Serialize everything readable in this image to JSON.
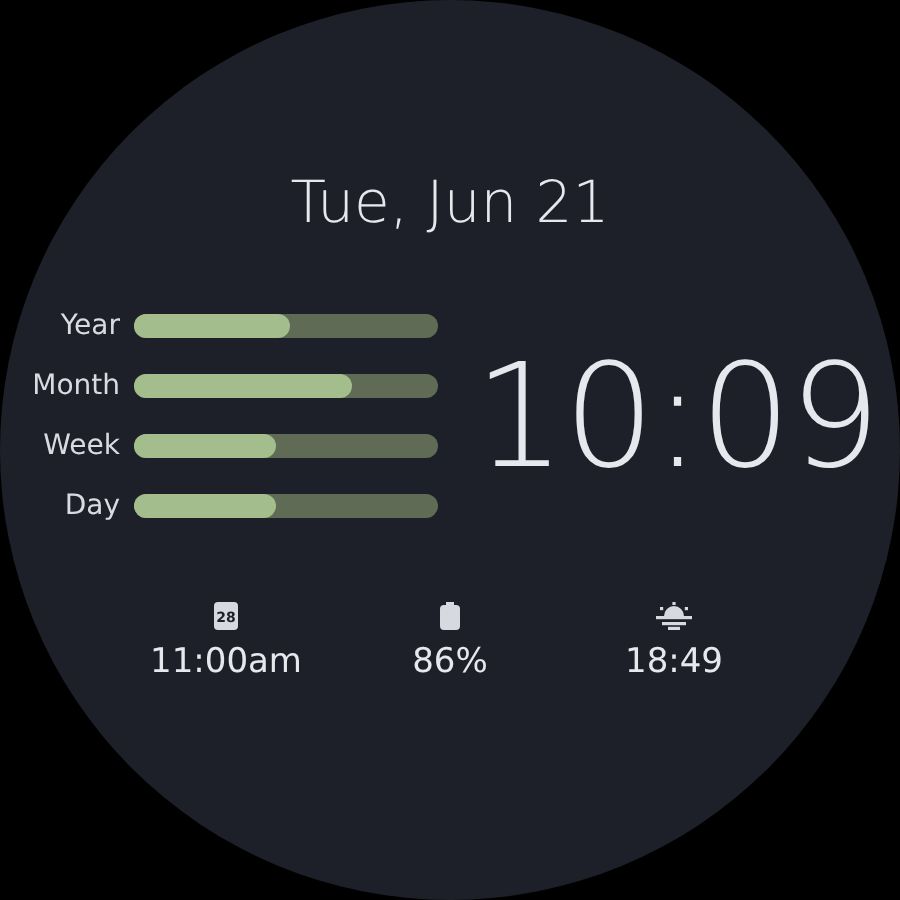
{
  "date": "Tue, Jun 21",
  "progress": [
    {
      "label": "Year",
      "level": 0.51
    },
    {
      "label": "Month",
      "level": 0.72
    },
    {
      "label": "Week",
      "level": 0.47
    },
    {
      "label": "Day",
      "level": 0.47
    }
  ],
  "time": "10:09",
  "complications": [
    {
      "kind": "calendar",
      "icon_text": "28",
      "value": "11:00am"
    },
    {
      "kind": "battery",
      "value": "86%"
    },
    {
      "kind": "sunset",
      "value": "18:49"
    }
  ]
}
